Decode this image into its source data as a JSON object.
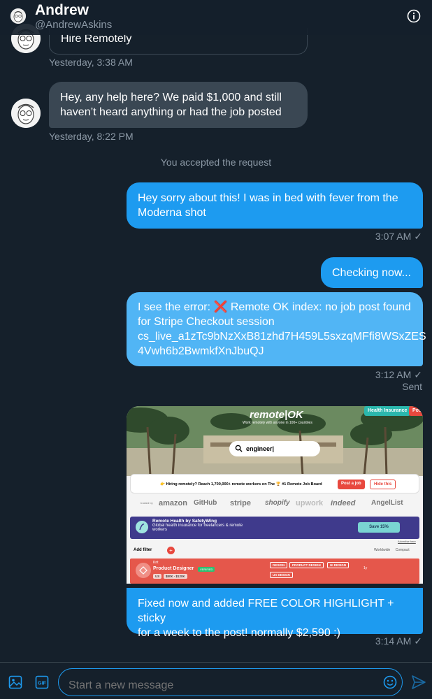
{
  "header": {
    "name": "Andrew",
    "handle": "@AndrewAskins"
  },
  "messages": {
    "card_title": "Hire Remotely",
    "card_time": "Yesterday, 3:38 AM",
    "in2_text_line1": "Hey, any help here? We paid $1,000 and still",
    "in2_text_line2": "haven’t heard anything or had the job posted",
    "in2_time": "Yesterday, 8:22 PM",
    "system": "You accepted the request",
    "out1_line1": "Hey sorry about this! I was in bed with fever from the",
    "out1_line2": "Moderna shot",
    "out1_time": "3:07 AM",
    "out2_text": "Checking now...",
    "out3_line1": "I see the error: ❌ Remote OK index: no job post found",
    "out3_line2": "for Stripe Checkout session",
    "out3_line3": "cs_live_a1zTc9bNzXxB81zhd7H459L5sxzqMFfi8WSxZES",
    "out3_line4": "4Vwh6b2BwmkfXnJbuQJ",
    "out3_time": "3:12 AM",
    "out3_status": "Sent",
    "out4_line1": "Fixed now and added FREE COLOR HIGHLIGHT + sticky",
    "out4_line2": "for a week to the post! normally $2,590 :)",
    "out4_time": "3:14 AM"
  },
  "screenshot": {
    "logo": "remote|OK",
    "tagline": "Work remotely with anyone in 100+ countries",
    "tag_health": "Health Insurance",
    "tag_post": "Post",
    "search_value": "engineer|",
    "hiring_text": "👉 Hiring remotely? Reach 1,700,000+ remote workers on The 🏆 #1 Remote Job Board",
    "post_job": "Post a job",
    "hide_this": "Hide this",
    "trusted_by": "trusted by",
    "logos": [
      "amazon",
      "GitHub",
      "stripe",
      "shopify",
      "upwork",
      "indeed",
      "AngelList"
    ],
    "safety_title": "Remote Health by SafetyWing",
    "safety_sub1": "Global health insurance for freelancers & remote",
    "safety_sub2": "workers",
    "save": "Save 15%",
    "advertise": "Advertise here",
    "add_filter": "Add filter",
    "worldwide": "Worldwide",
    "compact": "Compact",
    "job_company": "Krit",
    "job_title": "Product Designer",
    "job_verified": "VERIFIED",
    "job_loc": "US",
    "job_salary": "$80K - $120K",
    "job_tags": [
      "DESIGN",
      "PRODUCT DESIGN",
      "UI DESIGN",
      "UX DESIGN"
    ],
    "job_age": "1y"
  },
  "composer": {
    "placeholder": "Start a new message"
  },
  "colors": {
    "background": "#15202b",
    "accent": "#1d9bf0",
    "incoming_bubble": "#3a4753",
    "muted_text": "#8b98a5"
  }
}
